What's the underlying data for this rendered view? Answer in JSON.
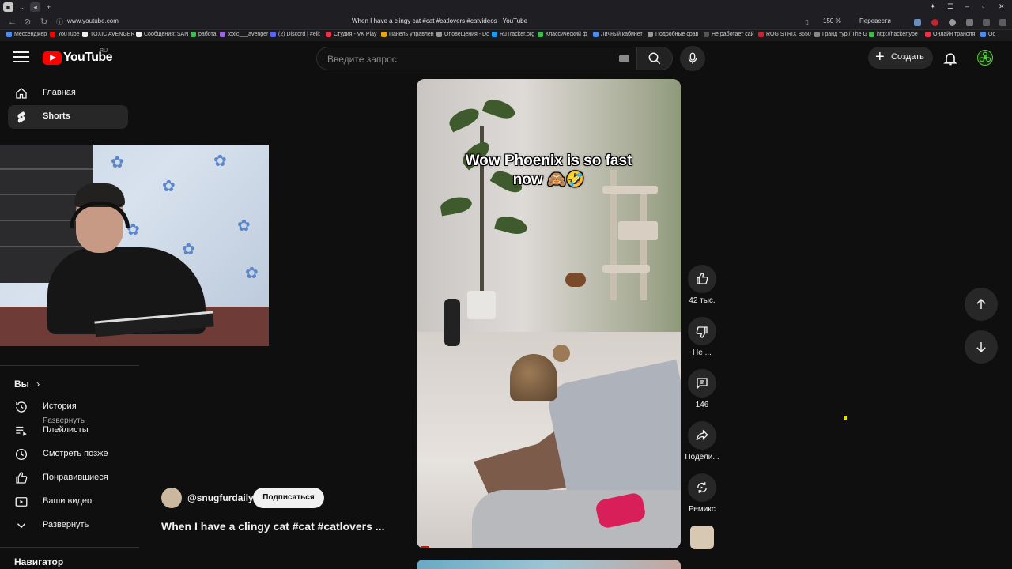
{
  "browser": {
    "url": "www.youtube.com",
    "tab_title": "When I have a clingy cat #cat #catlovers #catvideos - YouTube",
    "zoom": "150 %",
    "translate_label": "Перевести"
  },
  "bookmarks": [
    "Мессенджер",
    "YouTube",
    "TOXIC AVENGER",
    "Сообщения: SAN",
    "работа",
    "toxic___avenger",
    "(2) Discord | #elit",
    "Студия - VK Play",
    "Панель управлен",
    "Оповещения - Do",
    "RuTracker.org",
    "Классический ф",
    "Личный кабинет",
    "Подробные срав",
    "Не работает сай",
    "ROG STRIX B650",
    "Гранд тур / The G",
    "http://hackertype",
    "Онлайн трансля",
    "Ос"
  ],
  "header": {
    "logo_text": "YouTube",
    "logo_region": "RU",
    "search_placeholder": "Введите запрос",
    "create_label": "Создать"
  },
  "sidebar": {
    "items": [
      {
        "label": "Главная",
        "icon": "home-icon"
      },
      {
        "label": "Shorts",
        "icon": "shorts-icon"
      }
    ],
    "expand_hidden": "Развернуть",
    "you_heading": "Вы",
    "you_items": [
      {
        "label": "История",
        "icon": "history-icon"
      },
      {
        "label": "Плейлисты",
        "icon": "playlists-icon"
      },
      {
        "label": "Смотреть позже",
        "icon": "watch-later-icon"
      },
      {
        "label": "Понравившиеся",
        "icon": "like-icon"
      },
      {
        "label": "Ваши видео",
        "icon": "your-videos-icon"
      },
      {
        "label": "Развернуть",
        "icon": "chevron-down-icon"
      }
    ],
    "navigator_heading": "Навигатор"
  },
  "short": {
    "caption_line1": "Wow Phoenix is so fast",
    "caption_line2": "now 🙈🤣",
    "channel": "@snugfurdaily",
    "subscribe_label": "Подписаться",
    "title": "When I have a clingy cat #cat #catlovers ...",
    "progress": 0.03
  },
  "actions": {
    "likes": "42 тыс.",
    "dislike": "Не ...",
    "comments": "146",
    "share": "Подели...",
    "remix": "Ремикс"
  },
  "colors": {
    "background": "#0f0f0f",
    "brand_red": "#ff0000",
    "surface": "#272727"
  }
}
